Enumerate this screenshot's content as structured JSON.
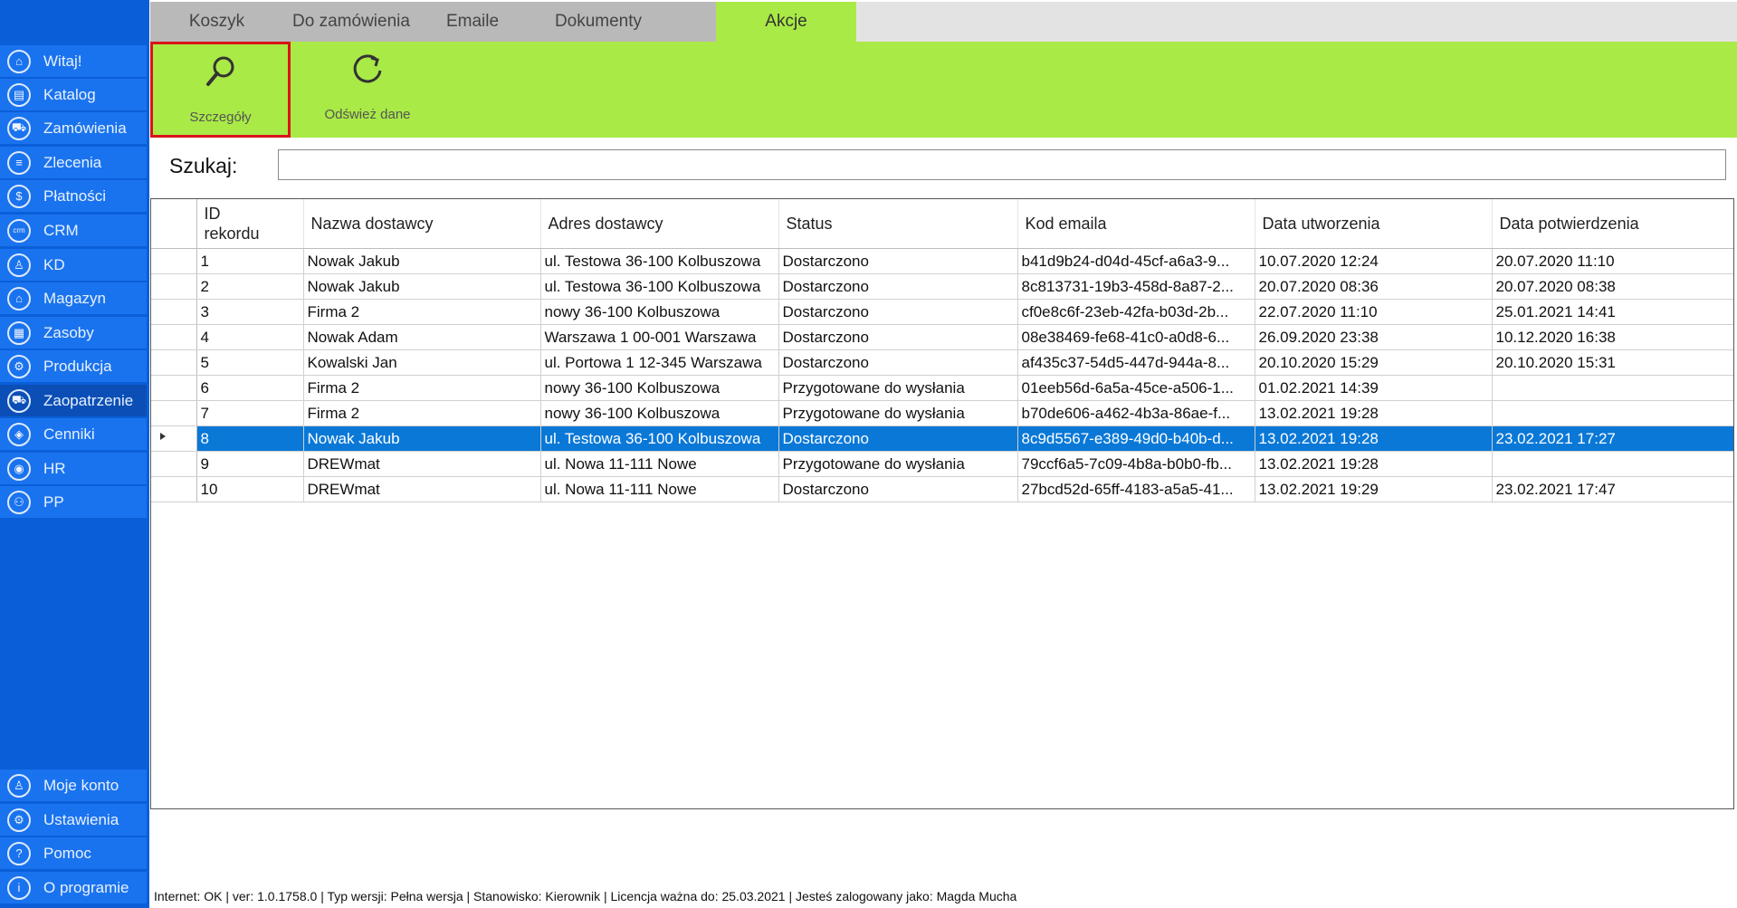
{
  "sidebar": {
    "items": [
      {
        "label": "Witaj!",
        "icon": "home-icon",
        "glyph": "⌂"
      },
      {
        "label": "Katalog",
        "icon": "book-icon",
        "glyph": "▤"
      },
      {
        "label": "Zamówienia",
        "icon": "cart-icon",
        "glyph": "⛟"
      },
      {
        "label": "Zlecenia",
        "icon": "list-icon",
        "glyph": "≡"
      },
      {
        "label": "Płatności",
        "icon": "dollar-icon",
        "glyph": "$"
      },
      {
        "label": "CRM",
        "icon": "crm-icon",
        "glyph": "crm"
      },
      {
        "label": "KD",
        "icon": "person-icon",
        "glyph": "♙"
      },
      {
        "label": "Magazyn",
        "icon": "warehouse-icon",
        "glyph": "⌂"
      },
      {
        "label": "Zasoby",
        "icon": "resources-icon",
        "glyph": "▦"
      },
      {
        "label": "Produkcja",
        "icon": "production-icon",
        "glyph": "⚙"
      },
      {
        "label": "Zaopatrzenie",
        "icon": "truck-icon",
        "glyph": "⛟"
      },
      {
        "label": "Cenniki",
        "icon": "tag-icon",
        "glyph": "◈"
      },
      {
        "label": "HR",
        "icon": "hr-icon",
        "glyph": "◉"
      },
      {
        "label": "PP",
        "icon": "pp-icon",
        "glyph": "⚇"
      }
    ],
    "bottom": [
      {
        "label": "Moje konto",
        "icon": "account-icon",
        "glyph": "♙"
      },
      {
        "label": "Ustawienia",
        "icon": "settings-icon",
        "glyph": "⚙"
      },
      {
        "label": "Pomoc",
        "icon": "help-icon",
        "glyph": "?"
      },
      {
        "label": "O programie",
        "icon": "info-icon",
        "glyph": "i"
      }
    ],
    "active": "Zaopatrzenie"
  },
  "tabs": [
    "Koszyk",
    "Do zamówienia",
    "Emaile",
    "Dokumenty",
    "Akcje"
  ],
  "active_tab": "Akcje",
  "ribbon": {
    "details_label": "Szczegóły",
    "refresh_label": "Odśwież dane"
  },
  "search": {
    "label": "Szukaj:",
    "value": ""
  },
  "table": {
    "columns": [
      "ID\nrekordu",
      "Nazwa dostawcy",
      "Adres dostawcy",
      "Status",
      "Kod emaila",
      "Data utworzenia",
      "Data potwierdzenia"
    ],
    "rows": [
      [
        "1",
        "Nowak Jakub",
        "ul. Testowa 36-100 Kolbuszowa",
        "Dostarczono",
        "b41d9b24-d04d-45cf-a6a3-9...",
        "10.07.2020 12:24",
        "20.07.2020 11:10"
      ],
      [
        "2",
        "Nowak Jakub",
        "ul. Testowa 36-100 Kolbuszowa",
        "Dostarczono",
        "8c813731-19b3-458d-8a87-2...",
        "20.07.2020 08:36",
        "20.07.2020 08:38"
      ],
      [
        "3",
        " Firma 2",
        "nowy 36-100 Kolbuszowa",
        "Dostarczono",
        "cf0e8c6f-23eb-42fa-b03d-2b...",
        "22.07.2020 11:10",
        "25.01.2021 14:41"
      ],
      [
        "4",
        "Nowak Adam",
        "Warszawa 1 00-001 Warszawa",
        "Dostarczono",
        "08e38469-fe68-41c0-a0d8-6...",
        "26.09.2020 23:38",
        "10.12.2020 16:38"
      ],
      [
        "5",
        "Kowalski Jan",
        "ul. Portowa 1 12-345 Warszawa",
        "Dostarczono",
        "af435c37-54d5-447d-944a-8...",
        "20.10.2020 15:29",
        "20.10.2020 15:31"
      ],
      [
        "6",
        " Firma 2",
        "nowy 36-100 Kolbuszowa",
        "Przygotowane do wysłania",
        "01eeb56d-6a5a-45ce-a506-1...",
        "01.02.2021 14:39",
        ""
      ],
      [
        "7",
        " Firma 2",
        "nowy 36-100 Kolbuszowa",
        "Przygotowane do wysłania",
        "b70de606-a462-4b3a-86ae-f...",
        "13.02.2021 19:28",
        ""
      ],
      [
        "8",
        "Nowak Jakub",
        "ul. Testowa 36-100 Kolbuszowa",
        "Dostarczono",
        "8c9d5567-e389-49d0-b40b-d...",
        "13.02.2021 19:28",
        "23.02.2021 17:27"
      ],
      [
        "9",
        " DREWmat",
        "ul. Nowa 11-111 Nowe",
        "Przygotowane do wysłania",
        "79ccf6a5-7c09-4b8a-b0b0-fb...",
        "13.02.2021 19:28",
        ""
      ],
      [
        "10",
        " DREWmat",
        "ul. Nowa 11-111 Nowe",
        "Dostarczono",
        "27bcd52d-65ff-4183-a5a5-41...",
        "13.02.2021 19:29",
        "23.02.2021 17:47"
      ]
    ],
    "selected_row": 7
  },
  "statusbar": {
    "text": "Internet: OK  |   ver: 1.0.1758.0   |   Typ wersji: Pełna wersja   |   Stanowisko: Kierownik   |   Licencja ważna do: 25.03.2021   |   Jesteś zalogowany jako: Magda Mucha"
  },
  "colors": {
    "sidebar": "#1a73ee",
    "ribbon": "#a9ea46",
    "selection": "#0a78d7",
    "highlight_border": "#d9141a"
  }
}
